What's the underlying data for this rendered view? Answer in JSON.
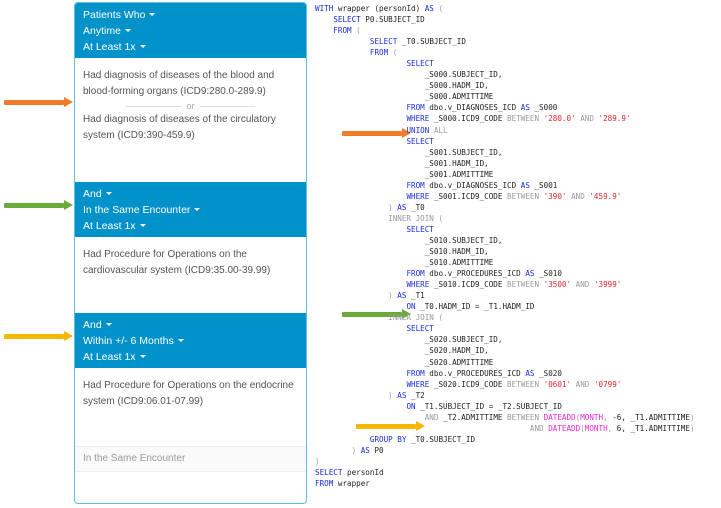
{
  "criteria_panel": {
    "groups": [
      {
        "header": [
          "Patients Who",
          "Anytime",
          "At Least 1x"
        ],
        "criteria": [
          "Had diagnosis of diseases of the blood and blood-forming organs (ICD9:280.0-289.9)",
          "Had diagnosis of diseases of the circulatory system (ICD9:390-459.9)"
        ],
        "separator": "or"
      },
      {
        "header": [
          "And",
          "In the Same Encounter",
          "At Least 1x"
        ],
        "criteria": [
          "Had Procedure for Operations on the cardiovascular system (ICD9:35.00-39.99)"
        ]
      },
      {
        "header": [
          "And",
          "Within +/- 6 Months",
          "At Least 1x"
        ],
        "criteria": [
          "Had Procedure for Operations on the endocrine system (ICD9:06.01-07.99)"
        ],
        "sub_option": "In the Same Encounter"
      }
    ]
  },
  "annotations": {
    "arrows": [
      {
        "name": "orange",
        "color": "#f07c2a"
      },
      {
        "name": "green",
        "color": "#6aaa3a"
      },
      {
        "name": "yellow",
        "color": "#f5b800"
      }
    ]
  },
  "colors": {
    "header_bg": "#0192c9",
    "keyword": "#1a2bdb",
    "gray_keyword": "#9a9a9a",
    "string": "#e0252b",
    "function": "#e826d4"
  },
  "sql": {
    "lines": [
      [
        [
          "",
          "WITH"
        ],
        [
          "",
          " wrapper (personId) "
        ],
        [
          "kw",
          "AS"
        ],
        [
          "gr",
          " ("
        ]
      ],
      [
        [
          "",
          "    "
        ],
        [
          "kw",
          "SELECT"
        ],
        [
          "",
          " P0.SUBJECT_ID"
        ]
      ],
      [
        [
          "",
          "    "
        ],
        [
          "kw",
          "FROM"
        ],
        [
          "gr",
          " ("
        ]
      ],
      [
        [
          "",
          "            "
        ],
        [
          "kw",
          "SELECT"
        ],
        [
          "",
          " _T0.SUBJECT_ID"
        ]
      ],
      [
        [
          "",
          "            "
        ],
        [
          "kw",
          "FROM"
        ],
        [
          "gr",
          " ("
        ]
      ],
      [
        [
          "",
          "                    "
        ],
        [
          "kw",
          "SELECT"
        ]
      ],
      [
        [
          "",
          "                        _S000.SUBJECT_ID,"
        ]
      ],
      [
        [
          "",
          "                        _S000.HADM_ID,"
        ]
      ],
      [
        [
          "",
          "                        _S000.ADMITTIME"
        ]
      ],
      [
        [
          "",
          "                    "
        ],
        [
          "kw",
          "FROM"
        ],
        [
          "",
          " dbo.v_DIAGNOSES_ICD "
        ],
        [
          "kw",
          "AS"
        ],
        [
          "",
          " _S000"
        ]
      ],
      [
        [
          "",
          "                    "
        ],
        [
          "kw",
          "WHERE"
        ],
        [
          "",
          " _S000.ICD9_CODE "
        ],
        [
          "gr",
          "BETWEEN"
        ],
        [
          "",
          " "
        ],
        [
          "str",
          "'280.0'"
        ],
        [
          "",
          " "
        ],
        [
          "gr",
          "AND"
        ],
        [
          "",
          " "
        ],
        [
          "str",
          "'289.9'"
        ]
      ],
      [
        [
          "",
          "                    "
        ],
        [
          "kw",
          "UNION"
        ],
        [
          "gr",
          " ALL"
        ]
      ],
      [
        [
          "",
          "                    "
        ],
        [
          "kw",
          "SELECT"
        ]
      ],
      [
        [
          "",
          "                        _S001.SUBJECT_ID,"
        ]
      ],
      [
        [
          "",
          "                        _S001.HADM_ID,"
        ]
      ],
      [
        [
          "",
          "                        _S001.ADMITTIME"
        ]
      ],
      [
        [
          "",
          "                    "
        ],
        [
          "kw",
          "FROM"
        ],
        [
          "",
          " dbo.v_DIAGNOSES_ICD "
        ],
        [
          "kw",
          "AS"
        ],
        [
          "",
          " _S001"
        ]
      ],
      [
        [
          "",
          "                    "
        ],
        [
          "kw",
          "WHERE"
        ],
        [
          "",
          " _S001.ICD9_CODE "
        ],
        [
          "gr",
          "BETWEEN"
        ],
        [
          "",
          " "
        ],
        [
          "str",
          "'390'"
        ],
        [
          "",
          " "
        ],
        [
          "gr",
          "AND"
        ],
        [
          "",
          " "
        ],
        [
          "str",
          "'459.9'"
        ]
      ],
      [
        [
          "gr",
          "                ) "
        ],
        [
          "kw",
          "AS"
        ],
        [
          "",
          " _T0"
        ]
      ],
      [
        [
          "gr",
          "                INNER JOIN ("
        ]
      ],
      [
        [
          "",
          "                    "
        ],
        [
          "kw",
          "SELECT"
        ]
      ],
      [
        [
          "",
          "                        _S010.SUBJECT_ID,"
        ]
      ],
      [
        [
          "",
          "                        _S010.HADM_ID,"
        ]
      ],
      [
        [
          "",
          "                        _S010.ADMITTIME"
        ]
      ],
      [
        [
          "",
          "                    "
        ],
        [
          "kw",
          "FROM"
        ],
        [
          "",
          " dbo.v_PROCEDURES_ICD "
        ],
        [
          "kw",
          "AS"
        ],
        [
          "",
          " _S010"
        ]
      ],
      [
        [
          "",
          "                    "
        ],
        [
          "kw",
          "WHERE"
        ],
        [
          "",
          " _S010.ICD9_CODE "
        ],
        [
          "gr",
          "BETWEEN"
        ],
        [
          "",
          " "
        ],
        [
          "str",
          "'3500'"
        ],
        [
          "",
          " "
        ],
        [
          "gr",
          "AND"
        ],
        [
          "",
          " "
        ],
        [
          "str",
          "'3999'"
        ]
      ],
      [
        [
          "gr",
          "                ) "
        ],
        [
          "kw",
          "AS"
        ],
        [
          "",
          " _T1"
        ]
      ],
      [
        [
          "",
          "                    "
        ],
        [
          "kw",
          "ON"
        ],
        [
          "",
          " _T0.HADM_ID = _T1.HADM_ID"
        ]
      ],
      [
        [
          "gr",
          "                INNER JOIN ("
        ]
      ],
      [
        [
          "",
          "                    "
        ],
        [
          "kw",
          "SELECT"
        ]
      ],
      [
        [
          "",
          "                        _S020.SUBJECT_ID,"
        ]
      ],
      [
        [
          "",
          "                        _S020.HADM_ID,"
        ]
      ],
      [
        [
          "",
          "                        _S020.ADMITTIME"
        ]
      ],
      [
        [
          "",
          "                    "
        ],
        [
          "kw",
          "FROM"
        ],
        [
          "",
          " dbo.v_PROCEDURES_ICD "
        ],
        [
          "kw",
          "AS"
        ],
        [
          "",
          " _S020"
        ]
      ],
      [
        [
          "",
          "                    "
        ],
        [
          "kw",
          "WHERE"
        ],
        [
          "",
          " _S020.ICD9_CODE "
        ],
        [
          "gr",
          "BETWEEN"
        ],
        [
          "",
          " "
        ],
        [
          "str",
          "'0601'"
        ],
        [
          "",
          " "
        ],
        [
          "gr",
          "AND"
        ],
        [
          "",
          " "
        ],
        [
          "str",
          "'0799'"
        ]
      ],
      [
        [
          "gr",
          "                ) "
        ],
        [
          "kw",
          "AS"
        ],
        [
          "",
          " _T2"
        ]
      ],
      [
        [
          "",
          "                    "
        ],
        [
          "kw",
          "ON"
        ],
        [
          "",
          " _T1.SUBJECT_ID = _T2.SUBJECT_ID"
        ]
      ],
      [
        [
          "",
          "                        "
        ],
        [
          "gr",
          "AND"
        ],
        [
          "",
          " _T2.ADMITTIME "
        ],
        [
          "gr",
          "BETWEEN"
        ],
        [
          "",
          " "
        ],
        [
          "fn",
          "DATEADD"
        ],
        [
          "gr",
          "("
        ],
        [
          "fn",
          "MONTH"
        ],
        [
          "gr",
          ","
        ],
        [
          "",
          " -6, _T1.ADMITTIME"
        ],
        [
          "gr",
          ")"
        ]
      ],
      [
        [
          "",
          "                                               "
        ],
        [
          "gr",
          "AND"
        ],
        [
          "",
          " "
        ],
        [
          "fn",
          "DATEADD"
        ],
        [
          "gr",
          "("
        ],
        [
          "fn",
          "MONTH"
        ],
        [
          "gr",
          ","
        ],
        [
          "",
          " 6, _T1.ADMITTIME"
        ],
        [
          "gr",
          ")"
        ]
      ],
      [
        [
          "",
          "            "
        ],
        [
          "kw",
          "GROUP BY"
        ],
        [
          "",
          " _T0.SUBJECT_ID"
        ]
      ],
      [
        [
          "gr",
          "        ) "
        ],
        [
          "kw",
          "AS"
        ],
        [
          "",
          " P0"
        ]
      ],
      [
        [
          "gr",
          ")"
        ]
      ],
      [
        [
          "kw",
          "SELECT"
        ],
        [
          "",
          " personId"
        ]
      ],
      [
        [
          "kw",
          "FROM"
        ],
        [
          "",
          " wrapper"
        ]
      ]
    ]
  }
}
